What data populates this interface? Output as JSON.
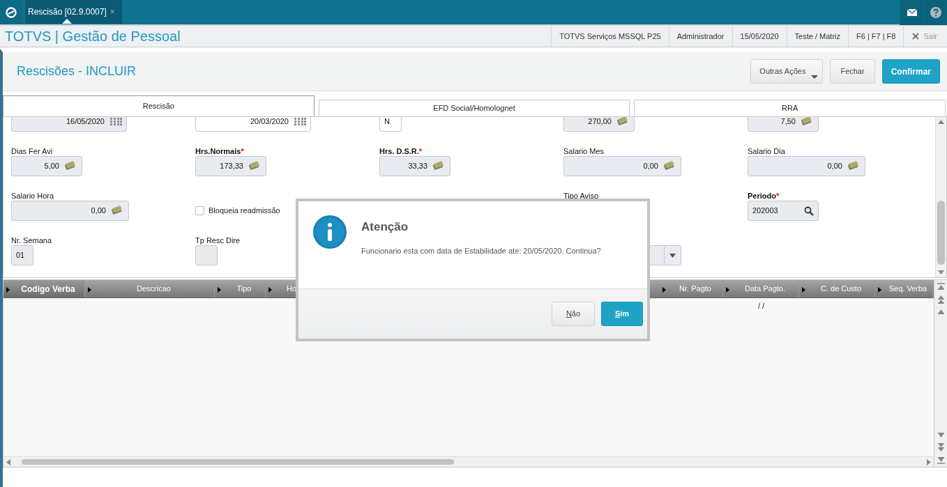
{
  "top_bar": {
    "tab": {
      "label": "Rescisão [02.9.0007]",
      "close": "×",
      "selected": true
    }
  },
  "header": {
    "title": "TOTVS | Gestão de Pessoal",
    "info": [
      "TOTVS Serviços MSSQL P25",
      "Administrador",
      "15/05/2020",
      "Teste / Matriz",
      "F6 | F7 | F8"
    ],
    "exit": "Sair"
  },
  "page": {
    "title": "Rescisões - INCLUIR",
    "buttons": [
      {
        "label": "Outras Ações",
        "kind": "dropdown"
      },
      {
        "label": "Fechar",
        "kind": "default"
      },
      {
        "label": "Confirmar",
        "kind": "primary"
      }
    ]
  },
  "tabs": [
    {
      "label": "Rescisão",
      "selected": true
    },
    {
      "label": "EFD Social/Homolognet",
      "selected": false
    },
    {
      "label": "RRA",
      "selected": false
    }
  ],
  "form_rows": [
    [
      {
        "kind": "date",
        "value": "16/05/2020"
      },
      {
        "kind": "date",
        "value": "20/03/2020"
      },
      {
        "kind": "text",
        "value": "N"
      },
      {
        "kind": "money",
        "value": "270,00"
      },
      {
        "kind": "money",
        "value": "7,50"
      }
    ],
    [
      {
        "kind": "money",
        "label": "Dias Fer Avi",
        "value": "5,00"
      },
      {
        "kind": "money",
        "label": "Hrs.Normais",
        "required_mark": "*",
        "value": "173,33"
      },
      {
        "kind": "money",
        "label": "Hrs. D.S.R.",
        "required_mark": "*",
        "value": "33,33"
      },
      {
        "kind": "money",
        "label": "Salario Mes",
        "value": "0,00"
      },
      {
        "kind": "money",
        "label": "Salario Dia",
        "value": "0,00"
      }
    ],
    [
      {
        "kind": "money",
        "label": "Salario Hora",
        "value": "0,00"
      },
      {
        "kind": "checkbox",
        "label": "Bloqueia readmissão",
        "checked": false
      },
      {
        "kind": "empty"
      },
      {
        "kind": "label",
        "label": "Tipo Aviso"
      },
      {
        "kind": "search",
        "label": "Periodo",
        "required_mark": "*",
        "value": "202003"
      }
    ],
    [
      {
        "kind": "text",
        "label": "Nr. Semana",
        "value": "01"
      },
      {
        "kind": "text",
        "label": "Tp Resc Dire"
      },
      {
        "kind": "empty"
      },
      {
        "kind": "select"
      },
      {
        "kind": "empty"
      }
    ]
  ],
  "grid": {
    "columns": [
      {
        "label": "Codigo Verba",
        "sorted": true
      },
      {
        "label": "Descricao",
        "sorted": false
      },
      {
        "label": "Tipo",
        "sorted": false
      },
      {
        "label": "Ho",
        "sorted": false
      },
      {
        "label": "Nr. Pagto",
        "sorted": false
      },
      {
        "label": "Data Pagto.",
        "sorted": false
      },
      {
        "label": "C. de Custo",
        "sorted": false
      },
      {
        "label": "Seq. Verba",
        "sorted": false
      }
    ],
    "rows": [
      {
        "cells": [
          null,
          null,
          null,
          null,
          null,
          "/ /",
          null,
          null
        ]
      }
    ]
  },
  "dialog": {
    "title": "Atenção",
    "message": "Funcionario esta com data de Estabilidade ate: 20/05/2020. Continua?",
    "buttons": [
      {
        "label": "Não",
        "kind": "default"
      },
      {
        "label": "Sim",
        "kind": "primary"
      }
    ]
  }
}
